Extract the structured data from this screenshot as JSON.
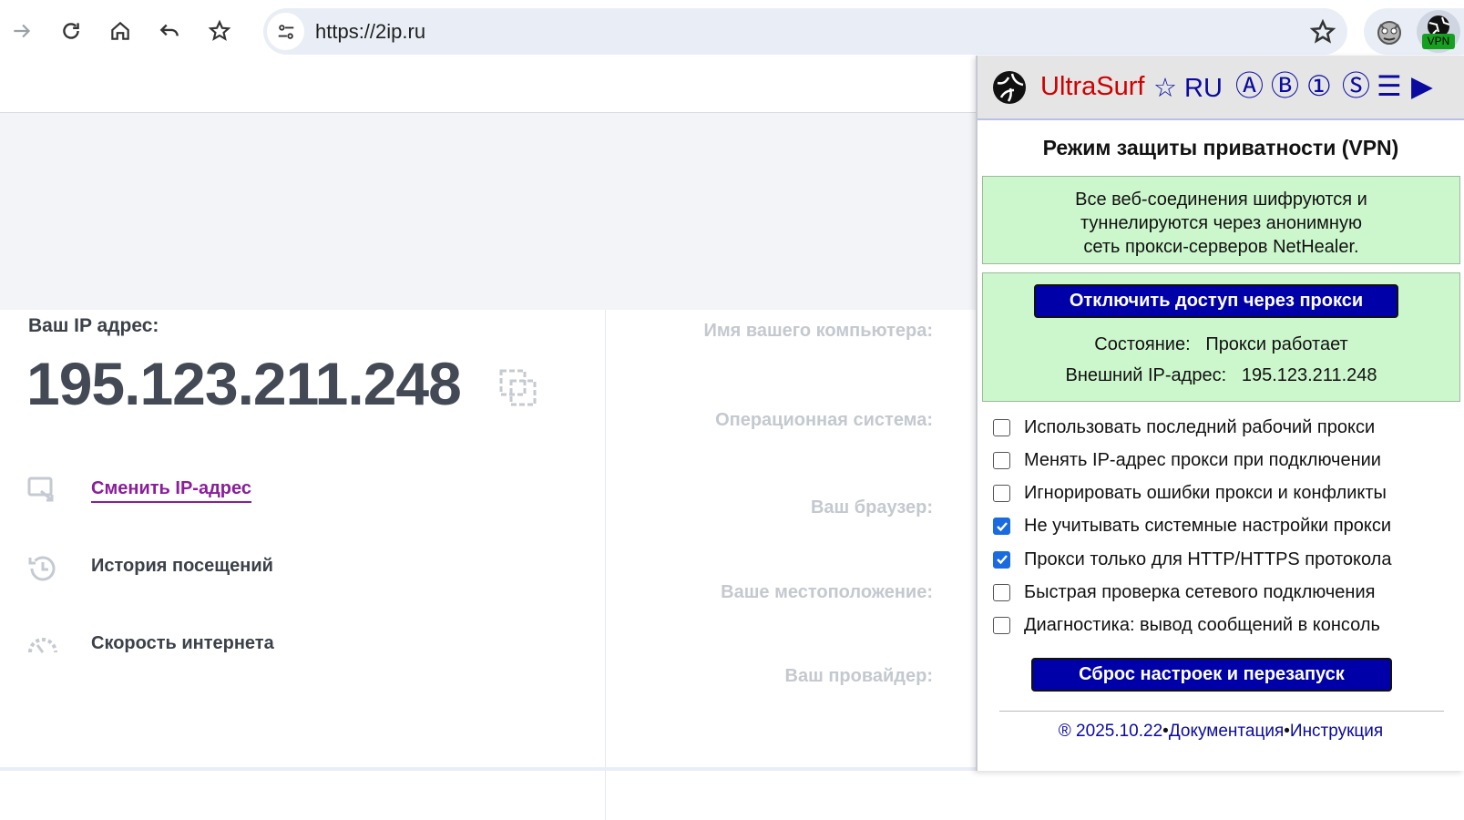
{
  "browser": {
    "url": "https://2ip.ru",
    "vpn_badge": "VPN"
  },
  "page": {
    "ip_label": "Ваш IP адрес:",
    "ip_value": "195.123.211.248",
    "links": {
      "change_ip": "Сменить IP-адрес",
      "history": "История посещений",
      "speed": "Скорость интернета"
    },
    "info_labels": {
      "computer_name": "Имя вашего компьютера:",
      "os": "Операционная система:",
      "browser": "Ваш браузер:",
      "location": "Ваше местоположение:",
      "provider": "Ваш провайдер:"
    }
  },
  "popup": {
    "brand": "UltraSurf",
    "star_lang": "☆ RU",
    "header_buttons": [
      "Ⓐ",
      "Ⓑ",
      "①",
      "Ⓢ",
      "☰",
      "▶"
    ],
    "title": "Режим защиты приватности (VPN)",
    "description": [
      "Все веб-соединения шифруются и",
      "туннелируются через анонимную",
      "сеть прокси-серверов NetHealer."
    ],
    "disable_button": "Отключить доступ через прокси",
    "status_label": "Состояние:",
    "status_value": "Прокси работает",
    "external_ip_label": "Внешний IP-адрес:",
    "external_ip_value": "195.123.211.248",
    "options": [
      {
        "label": "Использовать последний рабочий прокси",
        "checked": false
      },
      {
        "label": "Менять IP-адрес прокси при подключении",
        "checked": false
      },
      {
        "label": "Игнорировать ошибки прокси и конфликты",
        "checked": false
      },
      {
        "label": "Не учитывать системные настройки прокси",
        "checked": true
      },
      {
        "label": "Прокси только для HTTP/HTTPS протокола",
        "checked": true
      },
      {
        "label": "Быстрая проверка сетевого подключения",
        "checked": false
      },
      {
        "label": "Диагностика: вывод сообщений в консоль",
        "checked": false
      }
    ],
    "reset_button": "Сброс настроек и перезапуск",
    "footer": {
      "version": "® 2025.10.22",
      "docs": "Документация",
      "manual": "Инструкция",
      "separator": "•"
    }
  },
  "colors": {
    "accent_link": "#8a1d9a",
    "popup_button": "#0000a8",
    "green_panel": "#ccf7cc",
    "brand_red": "#d00000"
  }
}
